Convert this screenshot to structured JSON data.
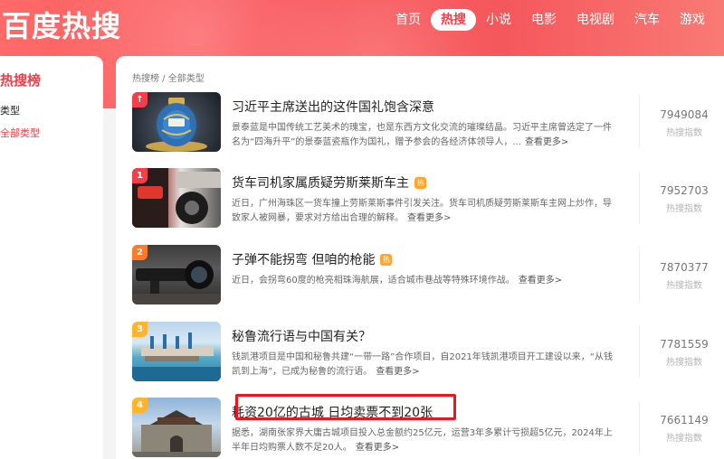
{
  "header": {
    "logo": "百度热搜",
    "nav": [
      {
        "label": "首页",
        "active": false
      },
      {
        "label": "热搜",
        "active": true
      },
      {
        "label": "小说",
        "active": false
      },
      {
        "label": "电影",
        "active": false
      },
      {
        "label": "电视剧",
        "active": false
      },
      {
        "label": "汽车",
        "active": false
      },
      {
        "label": "游戏",
        "active": false
      }
    ]
  },
  "sidebar": {
    "title": "热搜榜",
    "type_label": "类型",
    "all_types": "全部类型"
  },
  "breadcrumb": {
    "board": "热搜榜",
    "separator": " / ",
    "current": "全部类型"
  },
  "items": [
    {
      "rank": "↑",
      "rank_color": "#f23f4a",
      "title": "习近平主席送出的这件国礼饱含深意",
      "hot": false,
      "desc": "景泰蓝是中国传统工艺美术的瑰宝，也是东西方文化交流的璀璨结晶。习近平主席曾选定了一件名为“四海升平”的景泰蓝瓷瓶作为国礼，赠予参会的各经济体领导人，...",
      "more": "查看更多>",
      "count": "7949084",
      "count_label": "热搜指数",
      "thumb_icon": "vase-image"
    },
    {
      "rank": "1",
      "rank_color": "#f23f4a",
      "title": "货车司机家属质疑劳斯莱斯车主",
      "hot": true,
      "hot_label": "热",
      "desc": "近日，广州海珠区一货车撞上劳斯莱斯事件引发关注。货车司机质疑劳斯莱斯车主网上炒作，导致家人被网暴，要求对方给出合理的解释。",
      "more": "查看更多>",
      "count": "7952703",
      "count_label": "热搜指数",
      "thumb_icon": "truck-image"
    },
    {
      "rank": "2",
      "rank_color": "#ff7a29",
      "title": "子弹不能拐弯 但咱的枪能",
      "hot": true,
      "hot_label": "热",
      "desc": "近日，会拐弯60度的枪亮相珠海航展，适合城市巷战等特殊环境作战。",
      "more": "查看更多>",
      "count": "7870377",
      "count_label": "热搜指数",
      "thumb_icon": "gun-image"
    },
    {
      "rank": "3",
      "rank_color": "#ffb42c",
      "title": "秘鲁流行语与中国有关？",
      "hot": false,
      "desc": "钱凯港项目是中国和秘鲁共建“一带一路”合作项目，自2021年钱凯港项目开工建设以来，“从钱凯到上海”，已成为秘鲁的流行语。",
      "more": "查看更多>",
      "count": "7781559",
      "count_label": "热搜指数",
      "thumb_icon": "port-image"
    },
    {
      "rank": "4",
      "rank_color": "#ffb42c",
      "title": "耗资20亿的古城 日均卖票不到20张",
      "hot": false,
      "desc": "据悉，湖南张家界大庸古城项目投入总金额约25亿元，运营3年多累计亏损超5亿元，2024年上半年日均购票人数不足20人。",
      "more": "查看更多>",
      "count": "7661149",
      "count_label": "热搜指数",
      "thumb_icon": "ancient-city-image"
    }
  ],
  "colors": {
    "brand": "#f23f4a",
    "highlight_box": "#e8161f"
  }
}
